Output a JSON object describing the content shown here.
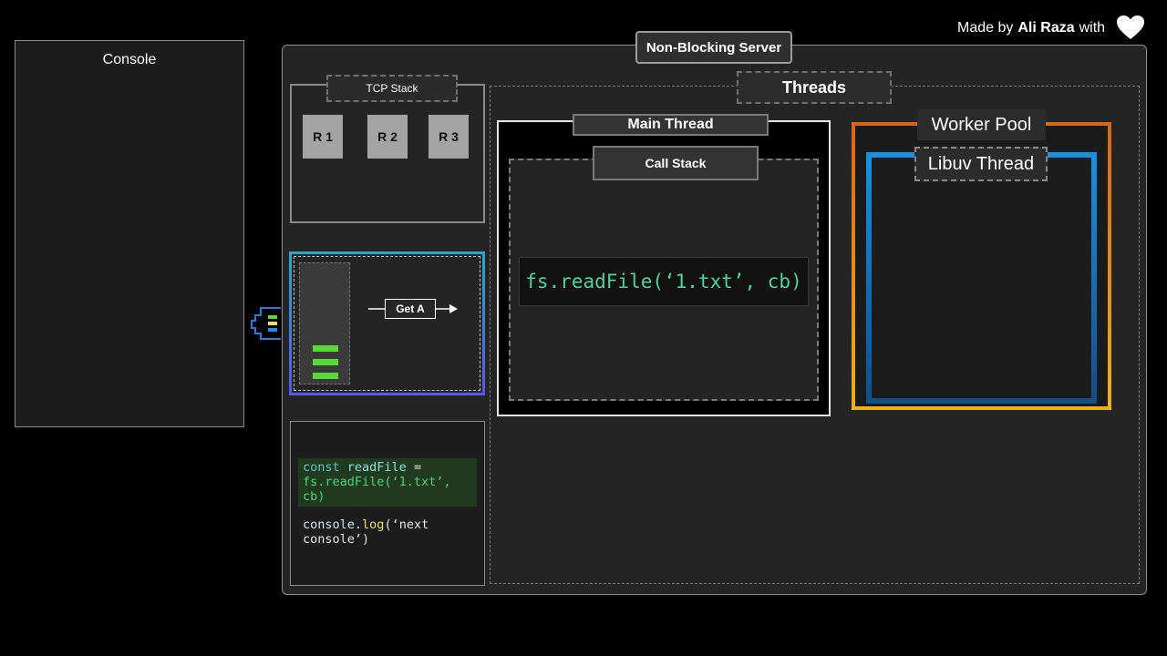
{
  "credit": {
    "prefix": "Made by",
    "author": "Ali Raza",
    "suffix": "with"
  },
  "console": {
    "title": "Console"
  },
  "server": {
    "title": "Non-Blocking Server"
  },
  "tcp": {
    "title": "TCP Stack",
    "requests": [
      "R 1",
      "R 2",
      "R 3"
    ]
  },
  "event_loop": {
    "arrow_label": "Get A"
  },
  "code": {
    "line1_kw": "const",
    "line1_var": "readFile",
    "line1_eq": "=",
    "line2": "fs.readFile(‘1.txt’,",
    "line3": "cb)",
    "line4_obj": "console",
    "line4_dot": ".",
    "line4_fn": "log",
    "line4_arg": "(‘next",
    "line5": "console’)"
  },
  "threads": {
    "title": "Threads",
    "main_thread": "Main Thread",
    "call_stack": "Call Stack",
    "stack_item": "fs.readFile(‘1.txt’, cb)",
    "worker_pool": "Worker Pool",
    "libuv_thread": "Libuv Thread"
  },
  "colors": {
    "green_bars": "#59d93a",
    "code_keyword": "#5ec2c2",
    "code_string": "#4fd17a",
    "worker_pool_border_top": "#d4661e",
    "worker_pool_border_bottom": "#f0b020",
    "libuv_border": "#1a8fe0",
    "queue_border_top": "#29a8c8",
    "queue_border_bottom": "#5a56e8"
  }
}
